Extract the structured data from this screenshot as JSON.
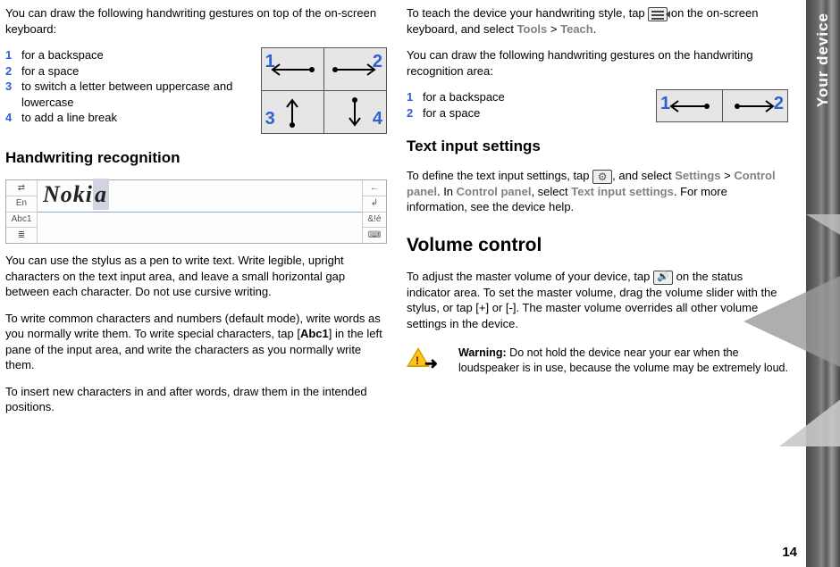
{
  "sideTab": "Your device",
  "pageNumber": "14",
  "col1": {
    "intro": "You can draw the following handwriting gestures on top of the on-screen keyboard:",
    "list": [
      {
        "n": "1",
        "t": "for a backspace"
      },
      {
        "n": "2",
        "t": "for a space"
      },
      {
        "n": "3",
        "t": "to switch a letter between uppercase and lowercase"
      },
      {
        "n": "4",
        "t": "to add a line break"
      }
    ],
    "cell_labels": {
      "c1": "1",
      "c2": "2",
      "c3": "3",
      "c4": "4"
    },
    "h2": "Handwriting recognition",
    "hw": {
      "left": [
        "⇄",
        "En",
        "Abc1",
        "≣"
      ],
      "right": [
        "←",
        "↲",
        "&!é",
        "⌨"
      ],
      "word_main": "Noki",
      "word_cursor": "a"
    },
    "p1": "You can use the stylus as a pen to write text. Write legible, upright characters on the text input area, and leave a small horizontal gap between each character. Do not use cursive writing.",
    "p2a": "To write common characters and numbers (default mode), write words as you normally write them. To write special characters, tap [",
    "p2b": "Abc1",
    "p2c": "] in the left pane of the input area, and write the characters as you normally write them.",
    "p3": "To insert new characters in and after words, draw them in the intended positions."
  },
  "col2": {
    "p1a": "To teach the device your handwriting style, tap ",
    "p1b": " on the on-screen keyboard, and select ",
    "bc1a": "Tools",
    "bc_sep": " > ",
    "bc1b": "Teach",
    "period": ".",
    "p2": "You can draw the following handwriting gestures on the handwriting recognition area:",
    "list": [
      {
        "n": "1",
        "t": "for a backspace"
      },
      {
        "n": "2",
        "t": "for a space"
      }
    ],
    "cell_labels": {
      "c1": "1",
      "c2": "2"
    },
    "h2": "Text input settings",
    "p3a": "To define the text input settings, tap ",
    "p3b": ", and select ",
    "bc2a": "Settings",
    "bc2b": "Control panel",
    "p3c": ". In ",
    "bc2c": "Control panel",
    "p3d": ", select ",
    "bc2d": "Text input settings",
    "p3e": ". For more information, see the device help.",
    "h1": "Volume control",
    "p4a": "To adjust the master volume of your device, tap ",
    "p4b": " on the status indicator area. To set the master volume, drag the volume slider with the stylus, or tap [+] or [-]. The master volume overrides all other volume settings in the device.",
    "warn_label": "Warning: ",
    "warn": "Do not hold the device near your ear when the loudspeaker is in use, because the volume may be extremely loud."
  }
}
